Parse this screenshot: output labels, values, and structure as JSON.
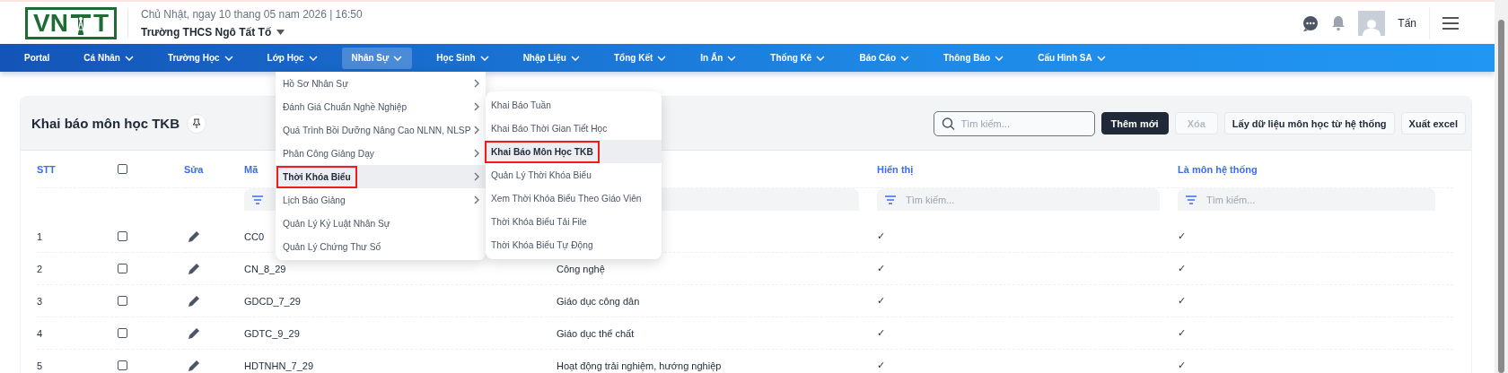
{
  "header": {
    "logo_left": "VN",
    "logo_right": "T",
    "date": "Chủ Nhật, ngay 10 thang 05 nam 2026 | 16:50",
    "school": "Trường THCS Ngô Tất Tố",
    "user": "Tấn"
  },
  "nav": [
    {
      "label": "Portal",
      "has_caret": false,
      "selected": false
    },
    {
      "label": "Cá Nhân",
      "has_caret": true,
      "selected": false
    },
    {
      "label": "Trường Học",
      "has_caret": true,
      "selected": false
    },
    {
      "label": "Lớp Học",
      "has_caret": true,
      "selected": false
    },
    {
      "label": "Nhân Sự",
      "has_caret": true,
      "selected": true
    },
    {
      "label": "Học Sinh",
      "has_caret": true,
      "selected": false
    },
    {
      "label": "Nhập Liệu",
      "has_caret": true,
      "selected": false
    },
    {
      "label": "Tổng Kết",
      "has_caret": true,
      "selected": false
    },
    {
      "label": "In Ấn",
      "has_caret": true,
      "selected": false
    },
    {
      "label": "Thống Kê",
      "has_caret": true,
      "selected": false
    },
    {
      "label": "Báo Cáo",
      "has_caret": true,
      "selected": false
    },
    {
      "label": "Thông Báo",
      "has_caret": true,
      "selected": false
    },
    {
      "label": "Cấu Hình SA",
      "has_caret": true,
      "selected": false
    }
  ],
  "menu": [
    {
      "label": "Hồ Sơ Nhân Sự",
      "has_submenu": true,
      "selected": false,
      "annotated": false
    },
    {
      "label": "Đánh Giá Chuẩn Nghề Nghiệp",
      "has_submenu": true,
      "selected": false,
      "annotated": false
    },
    {
      "label": "Quá Trình Bồi Dưỡng Nâng Cao NLNN, NLSP",
      "has_submenu": true,
      "selected": false,
      "annotated": false
    },
    {
      "label": "Phân Công Giảng Dạy",
      "has_submenu": true,
      "selected": false,
      "annotated": false
    },
    {
      "label": "Thời Khóa Biểu",
      "has_submenu": true,
      "selected": true,
      "annotated": true
    },
    {
      "label": "Lịch Báo Giảng",
      "has_submenu": true,
      "selected": false,
      "annotated": false
    },
    {
      "label": "Quản Lý Kỷ Luật Nhân Sự",
      "has_submenu": false,
      "selected": false,
      "annotated": false
    },
    {
      "label": "Quản Lý Chứng Thư Số",
      "has_submenu": false,
      "selected": false,
      "annotated": false
    }
  ],
  "submenu": [
    {
      "label": "Khai Báo Tuần",
      "selected": false,
      "annotated": false
    },
    {
      "label": "Khai Báo Thời Gian Tiết Học",
      "selected": false,
      "annotated": false
    },
    {
      "label": "Khai Báo Môn Học TKB",
      "selected": true,
      "annotated": true
    },
    {
      "label": "Quản Lý Thời Khóa Biểu",
      "selected": false,
      "annotated": false
    },
    {
      "label": "Xem Thời Khóa Biểu Theo Giáo Viên",
      "selected": false,
      "annotated": false
    },
    {
      "label": "Thời Khóa Biểu Tải File",
      "selected": false,
      "annotated": false
    },
    {
      "label": "Thời Khóa Biểu Tự Động",
      "selected": false,
      "annotated": false
    }
  ],
  "card": {
    "title": "Khai báo môn học TKB",
    "search_placeholder": "Tìm kiếm...",
    "buttons": [
      {
        "label": "Thêm mới",
        "kind": "primary"
      },
      {
        "label": "Xóa",
        "kind": "disabled"
      },
      {
        "label": "Lấy dữ liệu môn học từ hệ thống",
        "kind": "default"
      },
      {
        "label": "Xuất excel",
        "kind": "default"
      }
    ],
    "columns": [
      {
        "kind": "text",
        "label": "STT",
        "has_filter": false
      },
      {
        "kind": "checkbox",
        "checked": false,
        "has_filter": false
      },
      {
        "kind": "text",
        "label": "Sửa",
        "has_filter": false
      },
      {
        "kind": "text",
        "label": "Mã",
        "has_filter": true,
        "filter_icon": true
      },
      {
        "kind": "blank",
        "has_filter": true,
        "filter_icon": false
      },
      {
        "kind": "text",
        "label": "Hiển thị",
        "has_filter": true,
        "filter_icon": true,
        "filter_placeholder": "Tìm kiếm..."
      },
      {
        "kind": "text",
        "label": "Là môn hệ thống",
        "has_filter": true,
        "filter_icon": true,
        "filter_placeholder": "Tìm kiếm..."
      }
    ],
    "rows": [
      {
        "stt": "1",
        "checked": false,
        "code": "CC0",
        "shown": "✓",
        "system": "✓"
      },
      {
        "stt": "2",
        "checked": false,
        "code": "CN_8_29",
        "name": "Công nghệ",
        "shown": "✓",
        "system": "✓"
      },
      {
        "stt": "3",
        "checked": false,
        "code": "GDCD_7_29",
        "name": "Giáo dục công dân",
        "shown": "✓",
        "system": "✓"
      },
      {
        "stt": "4",
        "checked": false,
        "code": "GDTC_9_29",
        "name": "Giáo dục thể chất",
        "shown": "✓",
        "system": "✓"
      },
      {
        "stt": "5",
        "checked": false,
        "code": "HDTNHN_7_29",
        "name": "Hoạt động trải nghiệm, hướng nghiệp",
        "shown": "✓",
        "system": "✓"
      }
    ]
  }
}
